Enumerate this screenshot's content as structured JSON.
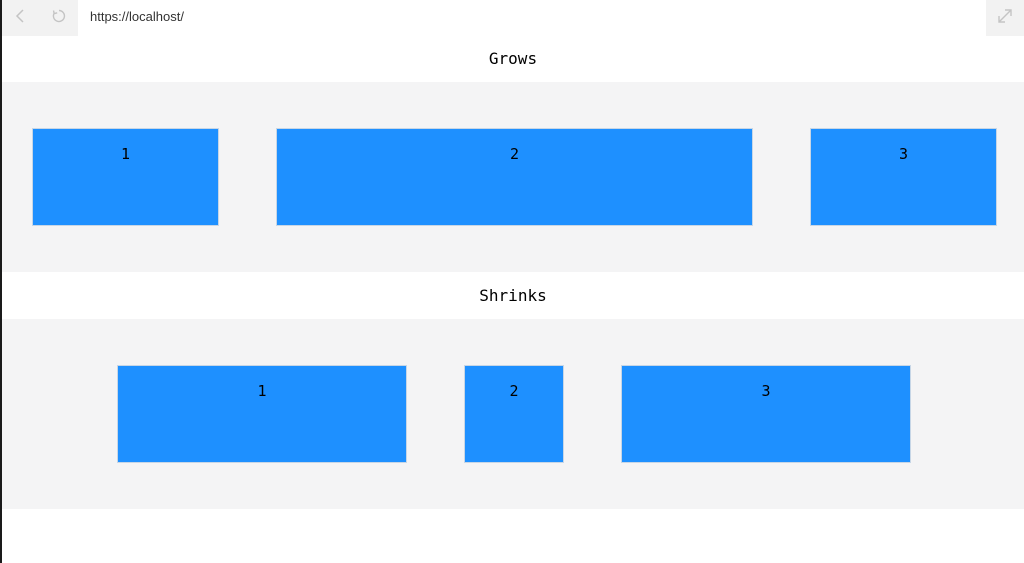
{
  "browser": {
    "url": "https://localhost/",
    "back_icon": "chevron-left-icon",
    "refresh_icon": "refresh-icon",
    "expand_icon": "expand-icon"
  },
  "sections": {
    "grows": {
      "title": "Grows",
      "items": [
        "1",
        "2",
        "3"
      ]
    },
    "shrinks": {
      "title": "Shrinks",
      "items": [
        "1",
        "2",
        "3"
      ]
    }
  },
  "colors": {
    "box": "#1e90ff",
    "panel": "#f4f4f5"
  }
}
